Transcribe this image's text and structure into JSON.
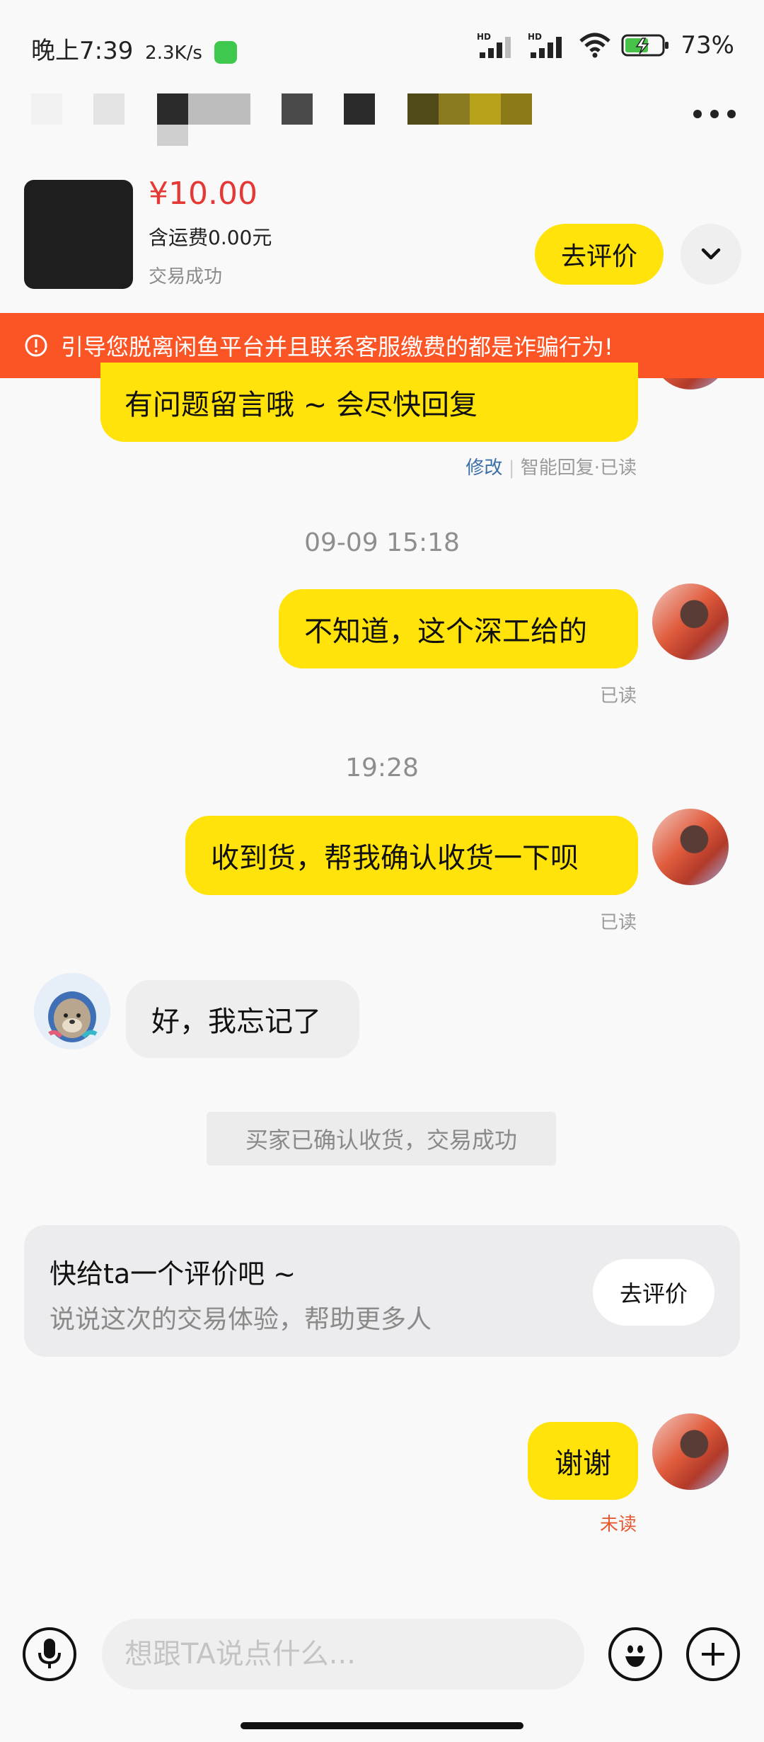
{
  "status_bar": {
    "time": "晚上7:39",
    "network_speed": "2.3K/s",
    "battery": "73%"
  },
  "header": {
    "more_label": "more-options"
  },
  "product": {
    "price": "¥10.00",
    "shipping": "含运费0.00元",
    "status": "交易成功",
    "review_button": "去评价"
  },
  "warning": {
    "text": "引导您脱离闲鱼平台并且联系客服缴费的都是诈骗行为!"
  },
  "messages": {
    "m1": {
      "text": "有问题留言哦 ~ 会尽快回复",
      "edit": "修改",
      "status": "智能回复·已读"
    },
    "t1": "09-09 15:18",
    "m2": {
      "text": "不知道，这个深工给的",
      "status": "已读"
    },
    "t2": "19:28",
    "m3": {
      "text": "收到货，帮我确认收货一下呗",
      "status": "已读"
    },
    "m4": {
      "text": "好，我忘记了"
    },
    "system": "买家已确认收货，交易成功",
    "review_card": {
      "title": "快给ta一个评价吧 ~",
      "subtitle": "说说这次的交易体验，帮助更多人",
      "button": "去评价"
    },
    "m5": {
      "text": "谢谢",
      "status": "未读"
    }
  },
  "input": {
    "placeholder": "想跟TA说点什么..."
  },
  "colors": {
    "accent_yellow": "#ffe30b",
    "warning_orange": "#fb5526",
    "price_red": "#e53935",
    "unread_red": "#e55a33"
  }
}
